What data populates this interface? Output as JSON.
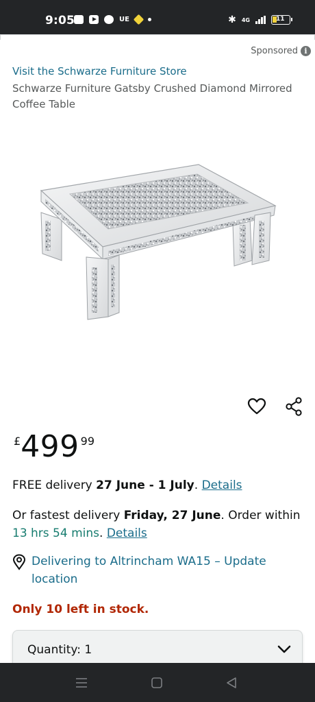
{
  "status_bar": {
    "time": "9:05",
    "carrier_text": "UE",
    "network": "4G",
    "battery": "11",
    "battery_color": "#f3d23b"
  },
  "listing": {
    "sponsored_label": "Sponsored",
    "store_link": "Visit the Schwarze Furniture Store",
    "title": "Schwarze Furniture Gatsby Crushed Diamond Mirrored Coffee Table",
    "price_currency": "£",
    "price_whole": "499",
    "price_fraction": "99"
  },
  "delivery": {
    "free_prefix": "FREE delivery ",
    "free_dates": "27 June - 1 July",
    "free_suffix": ". ",
    "details_label": "Details",
    "fastest_prefix": "Or fastest delivery ",
    "fastest_date": "Friday, 27 June",
    "fastest_mid": ". Order within ",
    "countdown": "13 hrs 54 mins",
    "countdown_suffix": ". ",
    "details2_label": "Details"
  },
  "location": {
    "text": "Delivering to Altrincham WA15 – Update location"
  },
  "stock": {
    "text": "Only 10 left in stock."
  },
  "quantity": {
    "label": "Quantity: 1"
  },
  "colors": {
    "link": "#1a6c8a",
    "teal": "#177c6f",
    "stock_red": "#b12704",
    "status_bg": "#232527"
  },
  "icons": {
    "wishlist": "heart-icon",
    "share": "share-icon",
    "location": "location-pin-icon",
    "quantity": "chevron-down-icon",
    "nav_menu": "menu-icon",
    "nav_home": "home-square-icon",
    "nav_back": "back-triangle-icon"
  }
}
